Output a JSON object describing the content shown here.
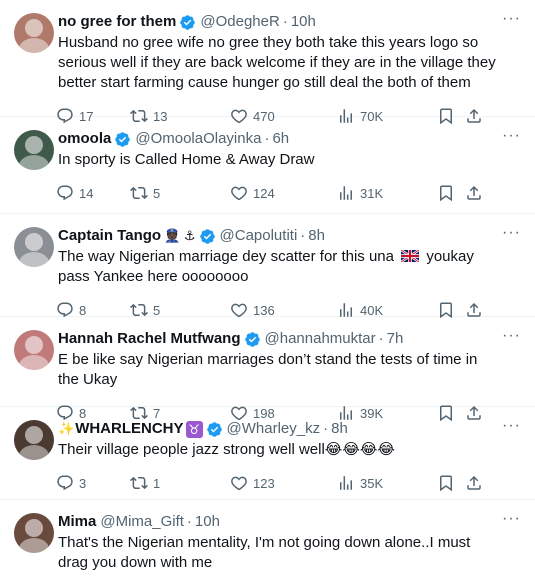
{
  "colors": {
    "text": "#0f1419",
    "muted": "#536471",
    "verified": "#1d9bf0",
    "divider": "#eff3f4"
  },
  "icons": {
    "more": "more-dots-icon",
    "verified": "verified-badge-icon",
    "reply": "reply-icon",
    "retweet": "retweet-icon",
    "like": "heart-icon",
    "views": "views-chart-icon",
    "bookmark": "bookmark-icon",
    "share": "share-icon"
  },
  "more_label": "···",
  "tweets": [
    {
      "name": "no gree for them",
      "handle": "@OdegheR",
      "dot": "·",
      "time": "10h",
      "text": "Husband no gree wife no gree they both take this years logo so serious well if they are back welcome if they are in the village they better start farming cause hunger go still deal the both of them",
      "replies": "17",
      "retweets": "13",
      "likes": "470",
      "views": "70K"
    },
    {
      "name": "omoola",
      "handle": "@OmoolaOlayinka",
      "dot": "·",
      "time": "6h",
      "text": "In sporty is Called Home  &  Away Draw",
      "replies": "14",
      "retweets": "5",
      "likes": "124",
      "views": "31K"
    },
    {
      "name": "Captain Tango",
      "name_emoji": "👮🏿 ⚓",
      "handle": "@Capolutiti",
      "dot": "·",
      "time": "8h",
      "text_before": "The way Nigerian marriage dey scatter for this una",
      "text_after": "youkay pass Yankee here oooooooo",
      "replies": "8",
      "retweets": "5",
      "likes": "136",
      "views": "40K"
    },
    {
      "name": "Hannah Rachel Mutfwang",
      "handle": "@hannahmuktar",
      "dot": "·",
      "time": "7h",
      "text": "E be like say Nigerian marriages don’t stand the tests of time in the  Ukay",
      "replies": "8",
      "retweets": "7",
      "likes": "198",
      "views": "39K"
    },
    {
      "name_prefix": "✨",
      "name": "WHARLENCHY",
      "name_suffix": "♉",
      "handle": "@Wharley_kz",
      "dot": "·",
      "time": "8h",
      "text": "Their village people jazz strong well well",
      "text_emoji": "😂😂😂😂",
      "replies": "3",
      "retweets": "1",
      "likes": "123",
      "views": "35K"
    },
    {
      "name": "Mima",
      "handle": "@Mima_Gift",
      "dot": "·",
      "time": "10h",
      "text": "That's the Nigerian mentality, I'm not going down alone..I must drag you down with me"
    }
  ]
}
